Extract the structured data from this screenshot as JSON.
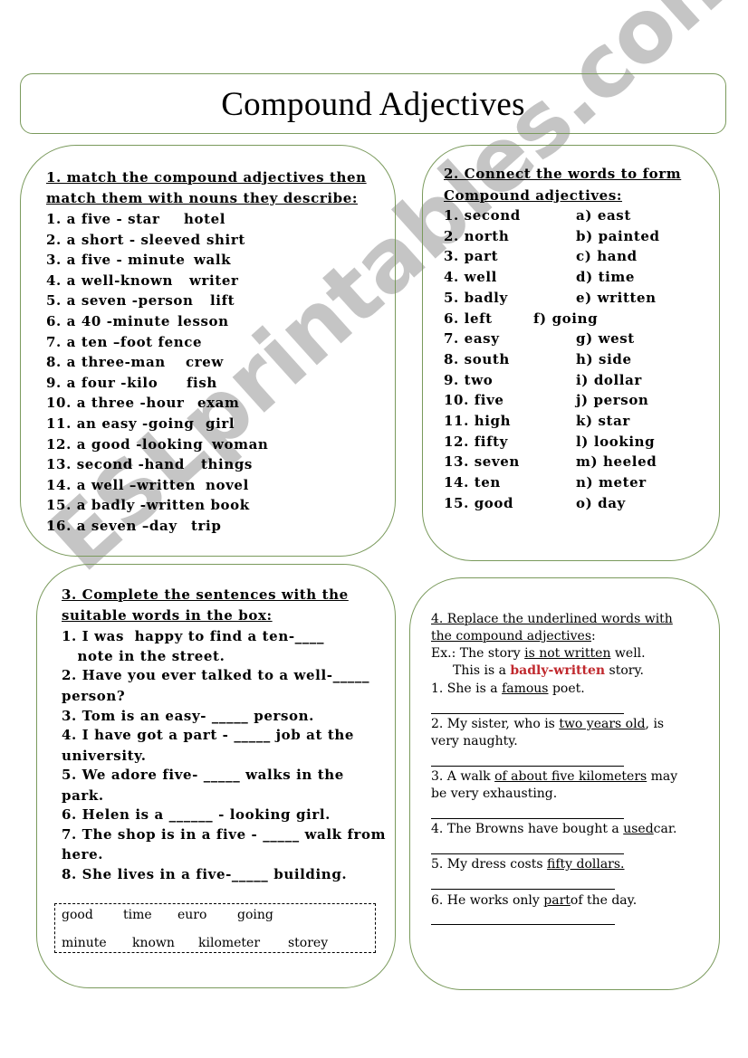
{
  "title": "Compound Adjectives",
  "watermark": "ESLprintables.com",
  "colors": {
    "box_border": "#7a9a5c",
    "highlight": "#c0282d",
    "watermark": "#969696"
  },
  "exercise1": {
    "heading_line1": "1. match the compound adjectives then",
    "heading_line2": "match them with nouns they describe:",
    "items": [
      {
        "adj": "1. a five - star",
        "noun": "hotel"
      },
      {
        "adj": "2. a short - sleeved",
        "noun": "shirt"
      },
      {
        "adj": "3. a five - minute",
        "noun": "walk"
      },
      {
        "adj": "4. a well-known",
        "noun": "writer"
      },
      {
        "adj": "5. a seven -person",
        "noun": "lift"
      },
      {
        "adj": "6. a 40 -minute",
        "noun": "lesson"
      },
      {
        "adj": "7. a ten –foot fence",
        "noun": ""
      },
      {
        "adj": "8. a three-man",
        "noun": "crew"
      },
      {
        "adj": "9. a four -kilo",
        "noun": "fish"
      },
      {
        "adj": "10. a three -hour",
        "noun": "exam"
      },
      {
        "adj": "11. an easy -going",
        "noun": "girl"
      },
      {
        "adj": "12. a good -looking",
        "noun": "woman"
      },
      {
        "adj": "13. second -hand",
        "noun": "things"
      },
      {
        "adj": "14. a well –written",
        "noun": "novel"
      },
      {
        "adj": "15. a badly -written book",
        "noun": ""
      },
      {
        "adj": "16. a seven –day",
        "noun": "trip"
      }
    ]
  },
  "exercise2": {
    "heading_line1": "2. Connect the words to form",
    "heading_line2": "Compound adjectives:",
    "left": [
      "1. second",
      "2. north",
      "3. part",
      "4. well",
      "5. badly",
      "6. left",
      "7. easy",
      "8. south",
      "9. two",
      "10. five",
      "11. high",
      "12. fifty",
      "13. seven",
      "14. ten",
      "15. good"
    ],
    "right": [
      "a) east",
      "b) painted",
      "c) hand",
      "d) time",
      "e) written",
      "f) going",
      "g) west",
      "h) side",
      "i) dollar",
      "j) person",
      "k) star",
      "l) looking",
      "m) heeled",
      "n) meter",
      "o) day"
    ]
  },
  "exercise3": {
    "heading_line1": "3. Complete the sentences with the",
    "heading_line2": "suitable words in the box:",
    "lines": [
      "1. I was  happy to find a ten-____",
      "   note in the street.",
      "2. Have you ever talked to a well-_____",
      "person?",
      "3. Tom is an easy- _____ person.",
      "4. I have got a part - _____ job at the",
      "university.",
      "5. We adore five- _____ walks in the",
      "park.",
      "6. Helen is a ______ - looking girl.",
      "7. The shop is in a five - _____ walk from",
      "here.",
      "8. She lives in a five-_____ building."
    ],
    "word_box_row1": [
      "good",
      "time",
      "euro",
      "going"
    ],
    "word_box_row2": [
      "minute",
      "known",
      "kilometer",
      "storey"
    ]
  },
  "exercise4": {
    "heading_line1": "4. Replace the underlined words with",
    "heading_line2": "the compound adjectives",
    "heading_colon": ":",
    "example": {
      "prefix": "Ex.: The story ",
      "underlined": "is not written",
      "suffix": " well.",
      "line2_prefix": "This is a ",
      "line2_highlight": "badly-written",
      "line2_suffix": " story."
    },
    "items": [
      {
        "pre": "1. She is a ",
        "u": "famous",
        "post": " poet.",
        "line2": ""
      },
      {
        "pre": "2. My sister, who is ",
        "u": "two years old",
        "post": ", is",
        "line2": "very naughty."
      },
      {
        "pre": "3. A walk ",
        "u": "of about five kilometers",
        "post": " may",
        "line2": "be very exhausting."
      },
      {
        "pre": "4. The Browns have bought a ",
        "u": "used",
        "post": "car.",
        "line2": ""
      },
      {
        "pre": "5. My dress costs ",
        "u": "fifty dollars.",
        "post": "",
        "line2": ""
      },
      {
        "pre": "6. He works only ",
        "u": "part",
        "post": "of the day.",
        "line2": ""
      }
    ]
  }
}
